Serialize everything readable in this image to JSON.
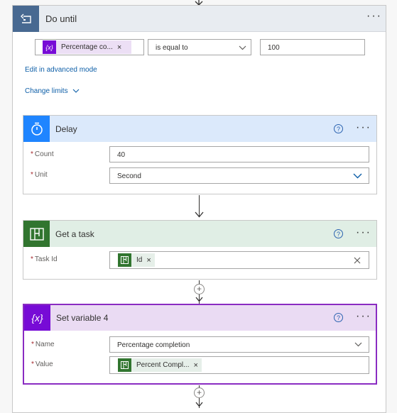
{
  "do_until": {
    "title": "Do until",
    "condition": {
      "token_label": "Percentage co...",
      "operator": "is equal to",
      "value": "100"
    },
    "edit_advanced_label": "Edit in advanced mode",
    "change_limits_label": "Change limits"
  },
  "delay": {
    "title": "Delay",
    "count_label": "Count",
    "count_value": "40",
    "unit_label": "Unit",
    "unit_value": "Second"
  },
  "get_task": {
    "title": "Get a task",
    "task_id_label": "Task Id",
    "token_label": "Id"
  },
  "set_variable": {
    "title": "Set variable 4",
    "name_label": "Name",
    "name_value": "Percentage completion",
    "value_label": "Value",
    "token_label": "Percent Compl..."
  },
  "common": {
    "required_marker": "*",
    "help_glyph": "?",
    "more_glyph": "···",
    "remove_glyph": "×",
    "add_glyph": "+"
  },
  "colors": {
    "loop_header": "#486991",
    "delay_header": "#dbe9fb",
    "delay_icon": "#1f85ff",
    "planner_header": "#e0eee5",
    "planner_icon": "#31752f",
    "variable_header": "#eadbf3",
    "variable_icon": "#770bd6",
    "variable_border": "#8a2cc2"
  }
}
